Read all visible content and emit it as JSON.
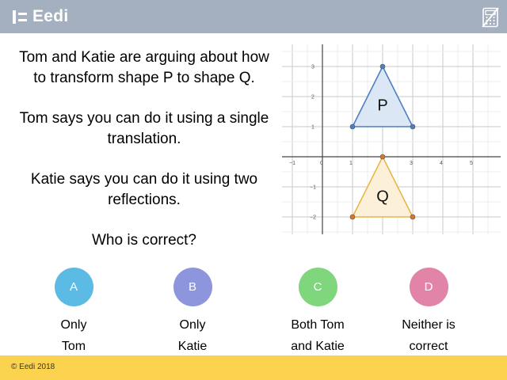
{
  "brand": {
    "name": "Eedi",
    "logo_icon": "eedi-logo-icon",
    "calculator_icon": "no-calculator-icon"
  },
  "question": {
    "paragraphs": [
      "Tom and Katie are arguing about how to transform shape P to shape Q.",
      "Tom says you can do it using a single translation.",
      "Katie says you can do it using two reflections.",
      "Who is correct?"
    ]
  },
  "graph": {
    "x_tick_labels": [
      "−1",
      "0",
      "1",
      "2",
      "3",
      "4",
      "5"
    ],
    "y_tick_labels": [
      "3",
      "2",
      "1",
      "−1",
      "−2"
    ],
    "shape_p": {
      "label": "P",
      "vertices": [
        [
          1,
          1
        ],
        [
          2,
          3
        ],
        [
          3,
          1
        ]
      ],
      "stroke": "#4a7fc1",
      "fill": "#dce7f5"
    },
    "shape_q": {
      "label": "Q",
      "vertices": [
        [
          1,
          -2
        ],
        [
          2,
          0
        ],
        [
          3,
          -2
        ]
      ],
      "stroke": "#e8b64a",
      "fill": "#fcf0d8",
      "point_color": "#d9772a"
    }
  },
  "options": [
    {
      "letter": "A",
      "line1": "Only",
      "line2": "Tom",
      "color": "#5bbbe5"
    },
    {
      "letter": "B",
      "line1": "Only",
      "line2": "Katie",
      "color": "#8d95dd"
    },
    {
      "letter": "C",
      "line1": "Both Tom",
      "line2": "and Katie",
      "color": "#7fd67d"
    },
    {
      "letter": "D",
      "line1": "Neither is",
      "line2": "correct",
      "color": "#e184a8"
    }
  ],
  "footer": {
    "copyright": "© Eedi 2018"
  }
}
